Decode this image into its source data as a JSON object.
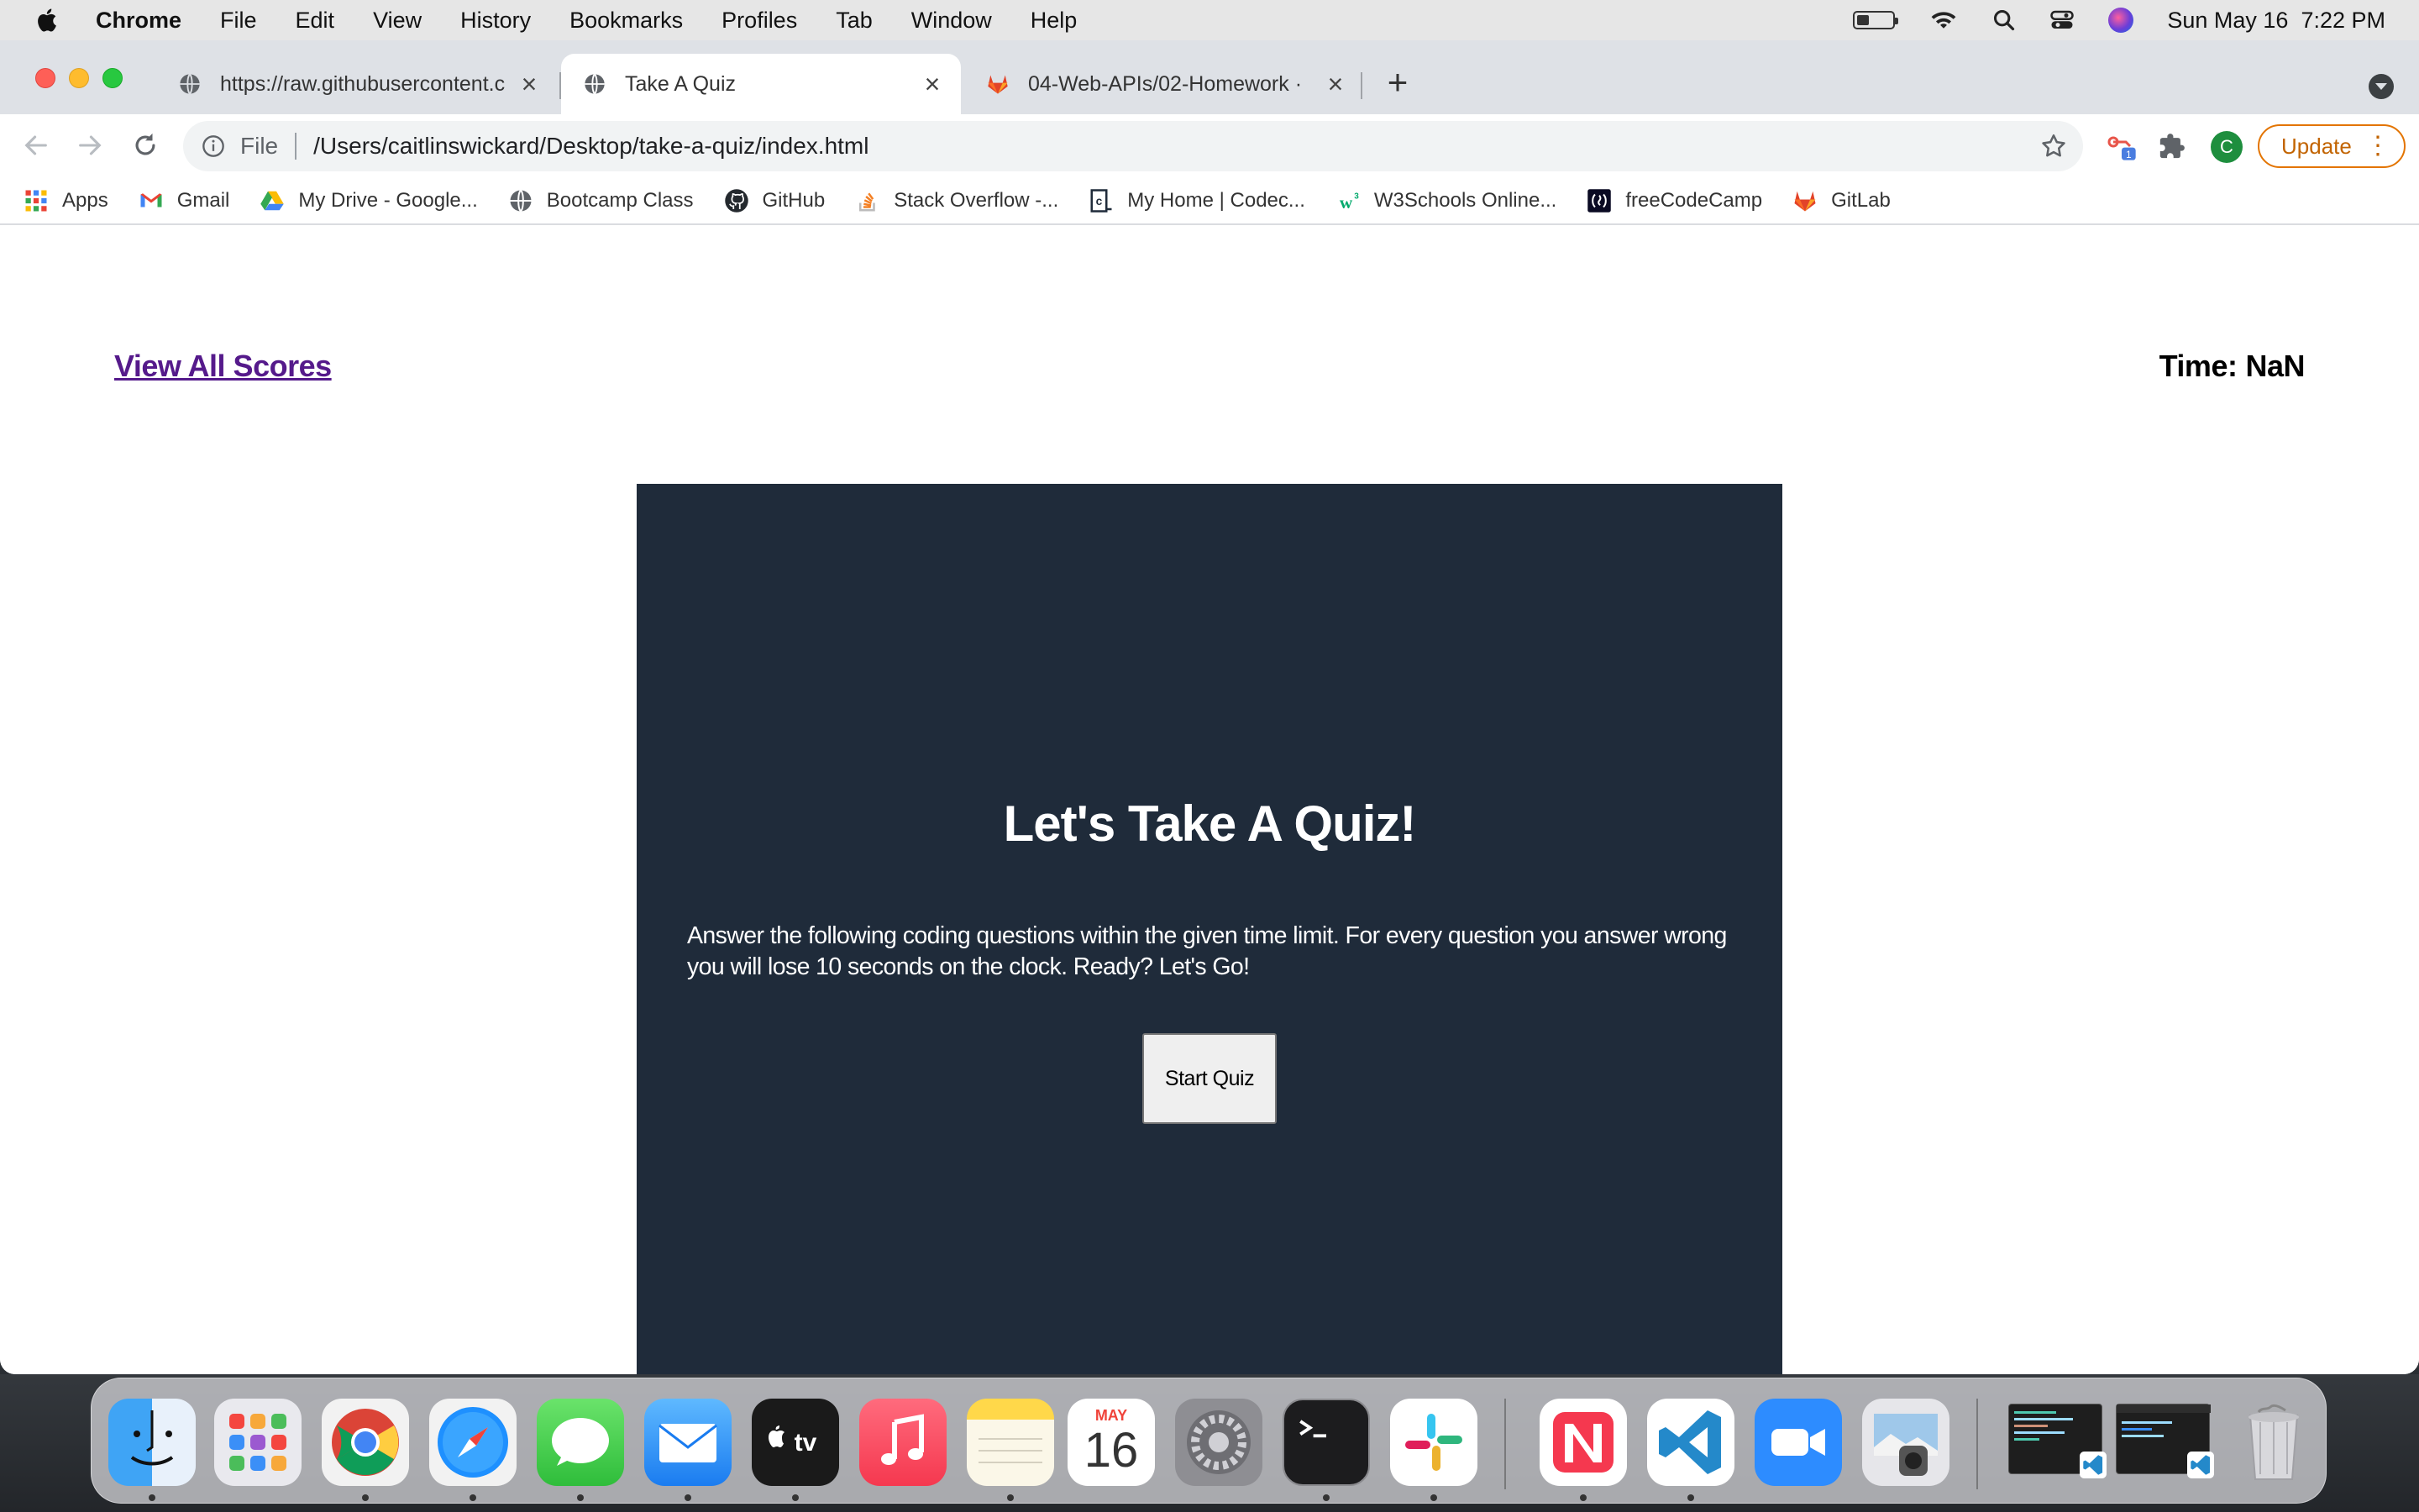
{
  "menubar": {
    "app_name": "Chrome",
    "items": [
      "File",
      "Edit",
      "View",
      "History",
      "Bookmarks",
      "Profiles",
      "Tab",
      "Window",
      "Help"
    ],
    "datetime": "Sun May 16  7:22 PM",
    "battery_level": 0.35
  },
  "tabs": [
    {
      "title": "https://raw.githubusercontent.c",
      "icon": "globe-icon",
      "active": false
    },
    {
      "title": "Take A Quiz",
      "icon": "globe-icon",
      "active": true
    },
    {
      "title": "04-Web-APIs/02-Homework · ",
      "icon": "gitlab-icon",
      "active": false
    }
  ],
  "omnibox": {
    "scheme_label": "File",
    "url": "/Users/caitlinswickard/Desktop/take-a-quiz/index.html"
  },
  "toolbar": {
    "extension_badge": "1",
    "profile_initial": "C",
    "update_label": "Update"
  },
  "bookmarks": [
    {
      "label": "Apps",
      "icon": "apps-grid-icon"
    },
    {
      "label": "Gmail",
      "icon": "gmail-icon"
    },
    {
      "label": "My Drive - Google...",
      "icon": "google-drive-icon"
    },
    {
      "label": "Bootcamp Class",
      "icon": "globe-icon"
    },
    {
      "label": "GitHub",
      "icon": "github-icon"
    },
    {
      "label": "Stack Overflow -...",
      "icon": "stackoverflow-icon"
    },
    {
      "label": "My Home | Codec...",
      "icon": "codecademy-icon"
    },
    {
      "label": "W3Schools Online...",
      "icon": "w3schools-icon"
    },
    {
      "label": "freeCodeCamp",
      "icon": "freecodecamp-icon"
    },
    {
      "label": "GitLab",
      "icon": "gitlab-icon"
    }
  ],
  "page": {
    "view_scores_label": "View All Scores",
    "timer_label": "Time:",
    "timer_value": "NaN",
    "quiz_title": "Let's Take A Quiz!",
    "quiz_description": "Answer the following coding questions within the given time limit. For every question you answer wrong you will lose 10 seconds on the clock. Ready? Let's Go!",
    "start_button_label": "Start Quiz"
  },
  "dock": {
    "calendar_month": "MAY",
    "calendar_day": "16",
    "apps": [
      "finder-icon",
      "launchpad-icon",
      "chrome-icon",
      "safari-icon",
      "messages-icon",
      "mail-icon",
      "apple-tv-icon",
      "music-icon",
      "notes-icon",
      "calendar-icon",
      "system-preferences-icon",
      "terminal-icon",
      "slack-icon",
      "news-icon",
      "vscode-icon",
      "zoom-icon",
      "preview-icon",
      "vscode-window-thumbnail",
      "vscode-window-thumbnail",
      "trash-icon"
    ]
  }
}
